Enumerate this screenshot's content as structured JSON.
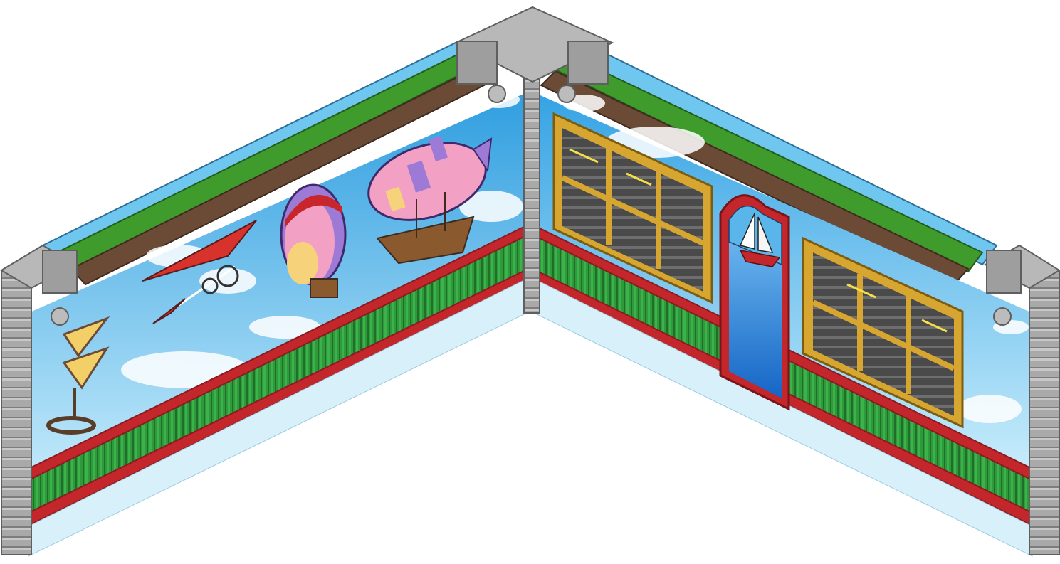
{
  "scene": {
    "kind": "isometric-room-corner",
    "walls": [
      "left-wall-mural",
      "right-wall-windows"
    ]
  },
  "colors": {
    "sky_top": "#3fa8e6",
    "sky_bottom": "#c9ecfb",
    "wainscot_green": "#2f9a3c",
    "wainscot_green_dark": "#1f6e2a",
    "trim_red": "#c3262b",
    "trim_red_dark": "#8c1a1e",
    "brick_gray": "#9a9a9a",
    "brick_light": "#bdbdbd",
    "frame_gold": "#d6a630",
    "frame_gold_dark": "#9b7416",
    "hills_green": "#3f9b2c",
    "track_brown": "#6b4a36",
    "door_water": "#1f7fd6",
    "door_arch_red": "#c3262b",
    "pastel_pink": "#f2a0c4",
    "pastel_purple": "#9c7ad6",
    "pastel_yellow": "#f6d27a",
    "ship_brown": "#8a5a2e"
  },
  "left_wall": {
    "mural_items": [
      "helicopter-kite-icon",
      "bicycle-glider-icon",
      "hot-air-balloon-icon",
      "airship-ship-icon"
    ]
  },
  "right_wall": {
    "features": [
      "window-left-icon",
      "arched-door-icon",
      "window-right-icon",
      "sailboat-glass-icon"
    ]
  }
}
